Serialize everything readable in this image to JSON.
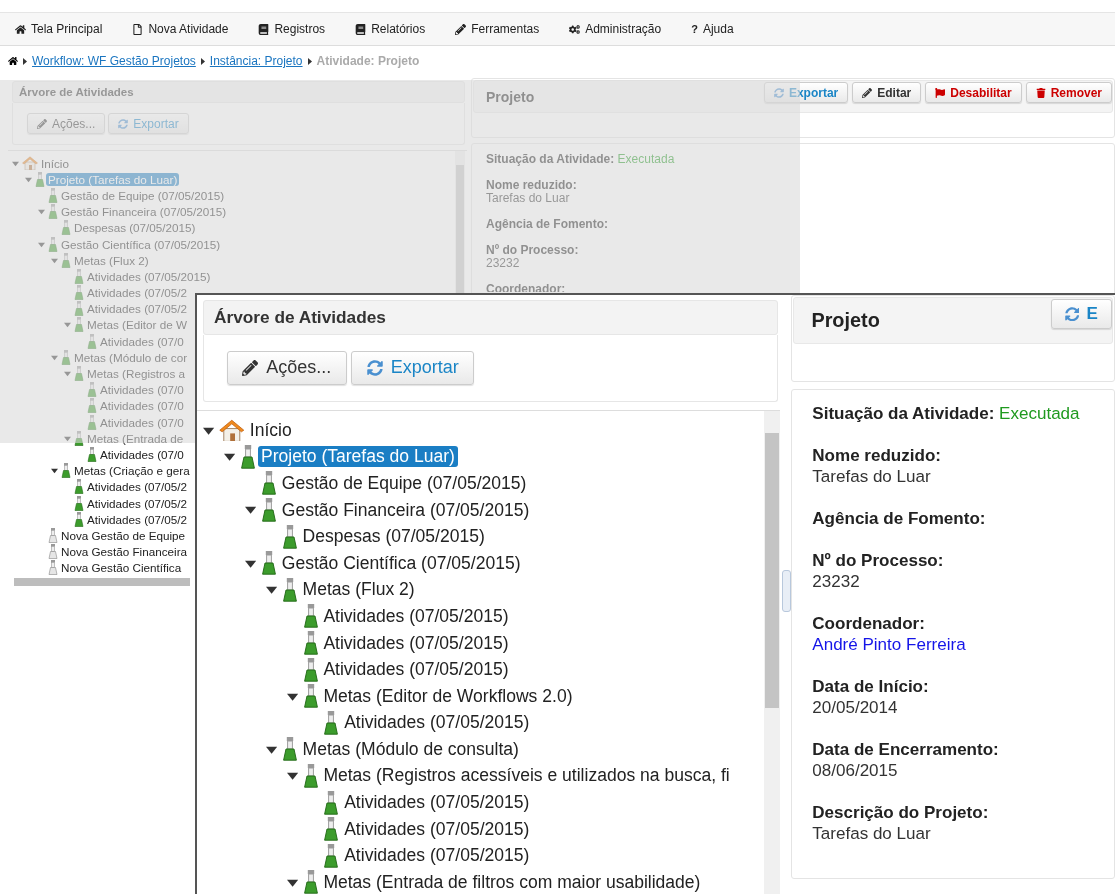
{
  "nav": [
    {
      "kind": "home",
      "label": "Tela Principal"
    },
    {
      "kind": "new",
      "label": "Nova Atividade"
    },
    {
      "kind": "records",
      "label": "Registros"
    },
    {
      "kind": "reports",
      "label": "Relatórios"
    },
    {
      "kind": "tools",
      "label": "Ferramentas"
    },
    {
      "kind": "admin",
      "label": "Administração"
    },
    {
      "kind": "help",
      "glyph": "?",
      "label": "Ajuda"
    }
  ],
  "breadcrumb": [
    {
      "kind": "link",
      "label": "Workflow: WF Gestão Projetos"
    },
    {
      "kind": "link",
      "label": "Instância: Projeto"
    },
    {
      "kind": "current",
      "label": "Atividade: Projeto"
    }
  ],
  "page": {
    "tree_panel": {
      "title": "Árvore de Atividades",
      "buttons": [
        {
          "kind": "actions",
          "label": "Ações..."
        },
        {
          "kind": "export",
          "label": "Exportar"
        }
      ],
      "tree": [
        {
          "label": "Início",
          "kind": "home",
          "selected": false,
          "expanded": true,
          "children": [
            {
              "label": "Projeto (Tarefas do Luar)",
              "kind": "item",
              "selected": true,
              "expanded": true,
              "children": [
                {
                  "label": "Gestão de Equipe (07/05/2015)",
                  "kind": "item",
                  "selected": false
                },
                {
                  "label": "Gestão Financeira (07/05/2015)",
                  "kind": "item",
                  "selected": false,
                  "expanded": true,
                  "children": [
                    {
                      "label": "Despesas (07/05/2015)",
                      "kind": "item",
                      "selected": false
                    }
                  ]
                },
                {
                  "label": "Gestão Científica (07/05/2015)",
                  "kind": "item",
                  "selected": false,
                  "expanded": true,
                  "children": [
                    {
                      "label": "Metas (Flux 2)",
                      "kind": "item",
                      "selected": false,
                      "expanded": true,
                      "children": [
                        {
                          "label": "Atividades (07/05/2015)",
                          "kind": "item",
                          "selected": false
                        },
                        {
                          "label": "Atividades (07/05/2",
                          "kind": "item",
                          "selected": false
                        },
                        {
                          "label": "Atividades (07/05/2",
                          "kind": "item",
                          "selected": false
                        },
                        {
                          "label": "Metas (Editor de W",
                          "kind": "item",
                          "selected": false,
                          "expanded": true,
                          "children": [
                            {
                              "label": "Atividades (07/0",
                              "kind": "item",
                              "selected": false
                            }
                          ]
                        }
                      ]
                    },
                    {
                      "label": "Metas (Módulo de cor",
                      "kind": "item",
                      "selected": false,
                      "expanded": true,
                      "children": [
                        {
                          "label": "Metas (Registros a",
                          "kind": "item",
                          "selected": false,
                          "expanded": true,
                          "children": [
                            {
                              "label": "Atividades (07/0",
                              "kind": "item",
                              "selected": false
                            },
                            {
                              "label": "Atividades (07/0",
                              "kind": "item",
                              "selected": false
                            },
                            {
                              "label": "Atividades (07/0",
                              "kind": "item",
                              "selected": false
                            }
                          ]
                        },
                        {
                          "label": "Metas (Entrada de",
                          "kind": "item",
                          "selected": false,
                          "expanded": true,
                          "children": [
                            {
                              "label": "Atividades (07/0",
                              "kind": "item",
                              "selected": false
                            }
                          ]
                        }
                      ]
                    },
                    {
                      "label": "Metas (Criação e gera",
                      "kind": "item",
                      "selected": false,
                      "expanded": true,
                      "children": [
                        {
                          "label": "Atividades (07/05/2",
                          "kind": "item",
                          "selected": false
                        },
                        {
                          "label": "Atividades (07/05/2",
                          "kind": "item",
                          "selected": false
                        },
                        {
                          "label": "Atividades (07/05/2",
                          "kind": "item",
                          "selected": false
                        }
                      ]
                    }
                  ]
                },
                {
                  "label": "Nova Gestão de Equipe",
                  "kind": "new",
                  "selected": false
                },
                {
                  "label": "Nova Gestão Financeira",
                  "kind": "new",
                  "selected": false
                },
                {
                  "label": "Nova Gestão Científica",
                  "kind": "new",
                  "selected": false
                }
              ]
            }
          ]
        }
      ]
    },
    "detail_panel": {
      "title": "Projeto",
      "buttons": [
        {
          "kind": "export",
          "label": "Exportar"
        },
        {
          "kind": "edit",
          "label": "Editar"
        },
        {
          "kind": "disable",
          "label": "Desabilitar"
        },
        {
          "kind": "remove",
          "label": "Remover"
        }
      ],
      "fields": [
        {
          "kind": "status",
          "label": "Situação da Atividade:",
          "value": "Executada"
        },
        {
          "kind": "text",
          "label": "Nome reduzido:",
          "value": "Tarefas do Luar"
        },
        {
          "kind": "text",
          "label": "Agência de Fomento:"
        },
        {
          "kind": "text",
          "label": "Nº do Processo:",
          "value": "23232"
        },
        {
          "kind": "text",
          "label": "Coordenador:"
        }
      ]
    }
  },
  "magnifier": {
    "tree_panel": {
      "title": "Árvore de Atividades",
      "buttons": [
        {
          "kind": "actions",
          "label": "Ações..."
        },
        {
          "kind": "export",
          "label": "Exportar"
        }
      ],
      "tree": [
        {
          "label": "Início",
          "kind": "home",
          "selected": false,
          "expanded": true,
          "children": [
            {
              "label": "Projeto (Tarefas do Luar)",
              "kind": "item",
              "selected": true,
              "expanded": true,
              "children": [
                {
                  "label": "Gestão de Equipe (07/05/2015)",
                  "kind": "item",
                  "selected": false
                },
                {
                  "label": "Gestão Financeira (07/05/2015)",
                  "kind": "item",
                  "selected": false,
                  "expanded": true,
                  "children": [
                    {
                      "label": "Despesas (07/05/2015)",
                      "kind": "item",
                      "selected": false
                    }
                  ]
                },
                {
                  "label": "Gestão Científica (07/05/2015)",
                  "kind": "item",
                  "selected": false,
                  "expanded": true,
                  "children": [
                    {
                      "label": "Metas (Flux 2)",
                      "kind": "item",
                      "selected": false,
                      "expanded": true,
                      "children": [
                        {
                          "label": "Atividades (07/05/2015)",
                          "kind": "item",
                          "selected": false
                        },
                        {
                          "label": "Atividades (07/05/2015)",
                          "kind": "item",
                          "selected": false
                        },
                        {
                          "label": "Atividades (07/05/2015)",
                          "kind": "item",
                          "selected": false
                        },
                        {
                          "label": "Metas (Editor de Workflows 2.0)",
                          "kind": "item",
                          "selected": false,
                          "expanded": true,
                          "children": [
                            {
                              "label": "Atividades (07/05/2015)",
                              "kind": "item",
                              "selected": false
                            }
                          ]
                        }
                      ]
                    },
                    {
                      "label": "Metas (Módulo de consulta)",
                      "kind": "item",
                      "selected": false,
                      "expanded": true,
                      "children": [
                        {
                          "label": "Metas (Registros acessíveis e utilizados na busca, fi",
                          "kind": "item",
                          "selected": false,
                          "expanded": true,
                          "children": [
                            {
                              "label": "Atividades (07/05/2015)",
                              "kind": "item",
                              "selected": false
                            },
                            {
                              "label": "Atividades (07/05/2015)",
                              "kind": "item",
                              "selected": false
                            },
                            {
                              "label": "Atividades (07/05/2015)",
                              "kind": "item",
                              "selected": false
                            }
                          ]
                        },
                        {
                          "label": "Metas (Entrada de filtros com maior usabilidade)",
                          "kind": "item",
                          "selected": false,
                          "expanded": true
                        }
                      ]
                    }
                  ]
                }
              ]
            }
          ]
        }
      ]
    },
    "detail_panel": {
      "title": "Projeto",
      "buttons": [
        {
          "kind": "export",
          "label": "E"
        }
      ],
      "fields": [
        {
          "kind": "status",
          "label": "Situação da Atividade:",
          "value": "Executada"
        },
        {
          "kind": "text",
          "label": "Nome reduzido:",
          "value": "Tarefas do Luar"
        },
        {
          "kind": "text",
          "label": "Agência de Fomento:"
        },
        {
          "kind": "text",
          "label": "Nº do Processo:",
          "value": "23232"
        },
        {
          "kind": "link",
          "label": "Coordenador:",
          "value": "André Pinto Ferreira"
        },
        {
          "kind": "text",
          "label": "Data de Início:",
          "value": "20/05/2014"
        },
        {
          "kind": "text",
          "label": "Data de Encerramento:",
          "value": "08/06/2015"
        },
        {
          "kind": "text",
          "label": "Descrição do Projeto:",
          "value": "Tarefas do Luar"
        }
      ]
    }
  }
}
